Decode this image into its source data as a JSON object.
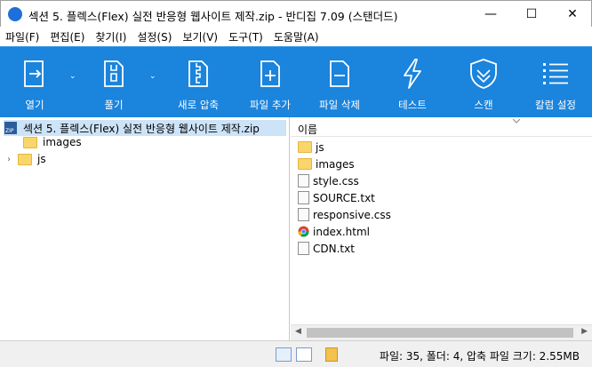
{
  "window": {
    "title": "섹션 5. 플렉스(Flex) 실전 반응형 웹사이트 제작.zip - 반디집 7.09 (스탠더드)",
    "minimize": "—",
    "maximize": "☐",
    "close": "✕"
  },
  "menu": [
    "파일(F)",
    "편집(E)",
    "찾기(I)",
    "설정(S)",
    "보기(V)",
    "도구(T)",
    "도움말(A)"
  ],
  "toolbar": [
    {
      "label": "열기",
      "icon": "open-archive-icon"
    },
    {
      "label": "풀기",
      "icon": "extract-icon"
    },
    {
      "label": "새로 압축",
      "icon": "new-archive-icon"
    },
    {
      "label": "파일 추가",
      "icon": "add-file-icon"
    },
    {
      "label": "파일 삭제",
      "icon": "delete-file-icon"
    },
    {
      "label": "테스트",
      "icon": "test-icon"
    },
    {
      "label": "스캔",
      "icon": "scan-icon"
    },
    {
      "label": "칼럼 설정",
      "icon": "column-settings-icon"
    }
  ],
  "tree": {
    "root": "섹션 5. 플렉스(Flex) 실전 반응형 웹사이트 제작.zip",
    "children": [
      "images",
      "js"
    ]
  },
  "list": {
    "column_name": "이름",
    "files": [
      {
        "name": "js",
        "type": "folder"
      },
      {
        "name": "images",
        "type": "folder"
      },
      {
        "name": "style.css",
        "type": "css"
      },
      {
        "name": "SOURCE.txt",
        "type": "txt"
      },
      {
        "name": "responsive.css",
        "type": "css"
      },
      {
        "name": "index.html",
        "type": "html"
      },
      {
        "name": "CDN.txt",
        "type": "txt"
      }
    ]
  },
  "status": {
    "text": "파일: 35, 폴더: 4, 압축 파일 크기: 2.55MB"
  },
  "colors": {
    "toolbar_bg": "#1b84dc",
    "selection_bg": "#cde3f7",
    "folder": "#f9d66b"
  }
}
